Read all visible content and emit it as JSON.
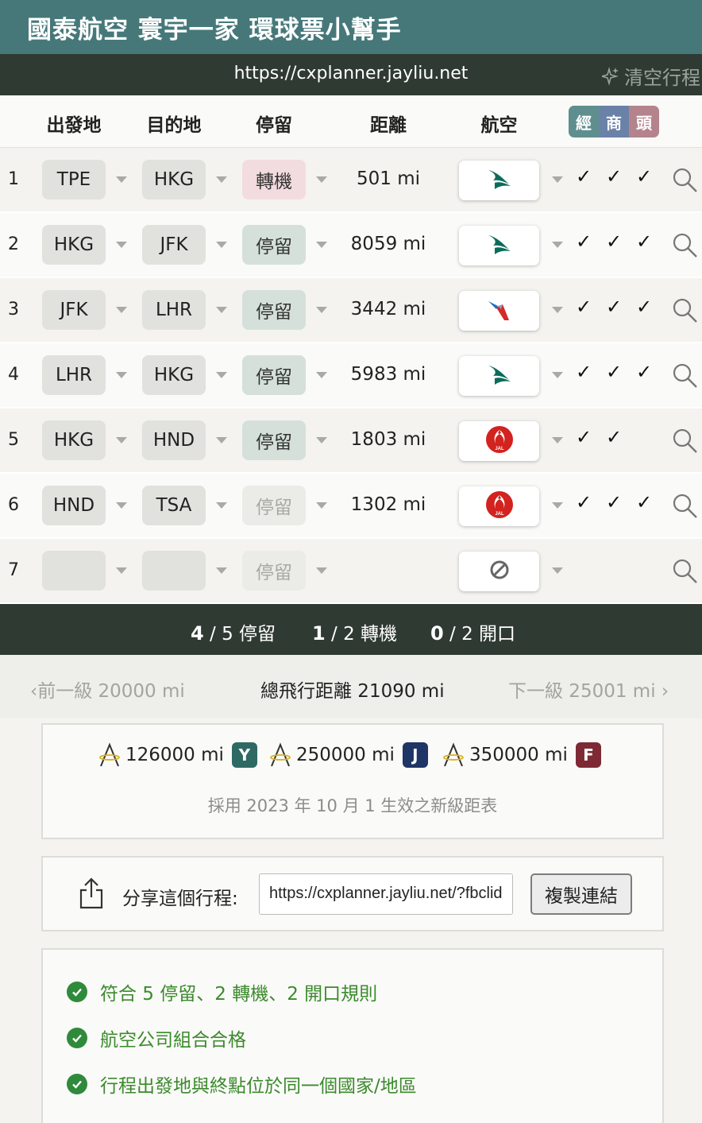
{
  "app": {
    "title": "國泰航空 寰宇一家 環球票小幫手",
    "url": "https://cxplanner.jayliu.net",
    "clear_label": "清空行程",
    "clear_icon": "sparkle-icon"
  },
  "table": {
    "headers": {
      "origin": "出發地",
      "destination": "目的地",
      "stop": "停留",
      "distance": "距離",
      "airline": "航空"
    },
    "classes": [
      {
        "label": "經",
        "color": "#5f8e8e"
      },
      {
        "label": "商",
        "color": "#6b82a8"
      },
      {
        "label": "頭",
        "color": "#b4838b"
      }
    ],
    "rows": [
      {
        "num": "1",
        "from": "TPE",
        "to": "HKG",
        "stop": "轉機",
        "stop_state": "transfer",
        "distance": "501 mi",
        "airline": "cathay-pacific-logo",
        "checks": [
          "✓",
          "✓",
          "✓"
        ]
      },
      {
        "num": "2",
        "from": "HKG",
        "to": "JFK",
        "stop": "停留",
        "stop_state": "stopover",
        "distance": "8059 mi",
        "airline": "cathay-pacific-logo",
        "checks": [
          "✓",
          "✓",
          "✓"
        ]
      },
      {
        "num": "3",
        "from": "JFK",
        "to": "LHR",
        "stop": "停留",
        "stop_state": "stopover",
        "distance": "3442 mi",
        "airline": "american-airlines-logo",
        "checks": [
          "✓",
          "✓",
          "✓"
        ]
      },
      {
        "num": "4",
        "from": "LHR",
        "to": "HKG",
        "stop": "停留",
        "stop_state": "stopover",
        "distance": "5983 mi",
        "airline": "cathay-pacific-logo",
        "checks": [
          "✓",
          "✓",
          "✓"
        ]
      },
      {
        "num": "5",
        "from": "HKG",
        "to": "HND",
        "stop": "停留",
        "stop_state": "stopover",
        "distance": "1803 mi",
        "airline": "jal-logo",
        "checks": [
          "✓",
          "✓",
          ""
        ]
      },
      {
        "num": "6",
        "from": "HND",
        "to": "TSA",
        "stop": "停留",
        "stop_state": "disabled",
        "distance": "1302 mi",
        "airline": "jal-logo",
        "checks": [
          "✓",
          "✓",
          "✓"
        ]
      },
      {
        "num": "7",
        "from": "",
        "to": "",
        "stop": "停留",
        "stop_state": "disabled",
        "distance": "",
        "airline": "none-icon",
        "checks": [
          "",
          "",
          ""
        ]
      }
    ]
  },
  "summary": {
    "stopovers_used": "4",
    "stopovers_text": "/ 5 停留",
    "transfers_used": "1",
    "transfers_text": "/ 2 轉機",
    "openjaws_used": "0",
    "openjaws_text": "/ 2 開口"
  },
  "tier": {
    "prev": "前一級 20000 mi",
    "total": "總飛行距離 21090 mi",
    "next": "下一級 25001 mi"
  },
  "fares": [
    {
      "miles": "126000 mi",
      "badge": "Y",
      "color": "#2e6a63"
    },
    {
      "miles": "250000 mi",
      "badge": "J",
      "color": "#1e3566"
    },
    {
      "miles": "350000 mi",
      "badge": "F",
      "color": "#7d2a35"
    }
  ],
  "fare_note": "採用 2023 年 10 月 1 生效之新級距表",
  "share": {
    "label": "分享這個行程:",
    "url": "https://cxplanner.jayliu.net/?fbclid",
    "copy_label": "複製連結"
  },
  "rules": [
    "符合 5 停留、2 轉機、2 開口規則",
    "航空公司組合合格",
    "行程出發地與終點位於同一個國家/地區"
  ]
}
